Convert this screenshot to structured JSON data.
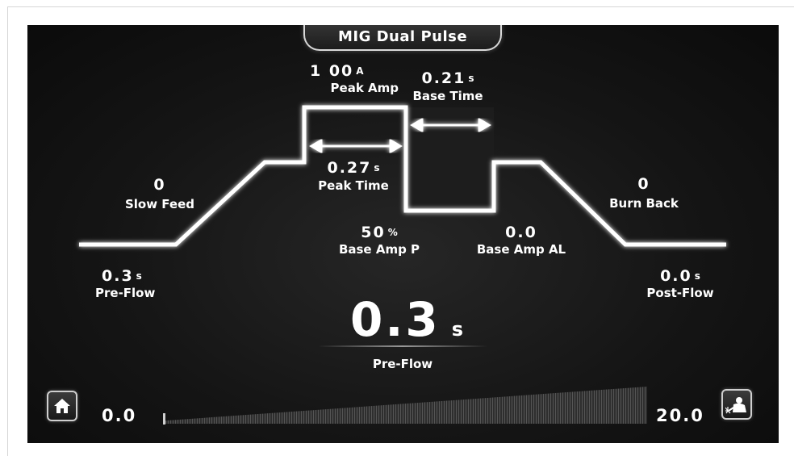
{
  "mode_title": "MIG Dual Pulse",
  "params": {
    "peak_amp": {
      "value": "1 00",
      "unit": "A",
      "label": "Peak Amp"
    },
    "base_time": {
      "value": "0.21",
      "unit": "s",
      "label": "Base Time"
    },
    "peak_time": {
      "value": "0.27",
      "unit": "s",
      "label": "Peak Time"
    },
    "slow_feed": {
      "value": "0",
      "label": "Slow Feed"
    },
    "burn_back": {
      "value": "0",
      "label": "Burn Back"
    },
    "base_amp_p": {
      "value": "50",
      "unit": "%",
      "label": "Base Amp P"
    },
    "base_amp_al": {
      "value": "0.0",
      "label": "Base Amp AL"
    },
    "pre_flow": {
      "value": "0.3",
      "unit": "s",
      "label": "Pre-Flow"
    },
    "post_flow": {
      "value": "0.0",
      "unit": "s",
      "label": "Post-Flow"
    }
  },
  "selected": {
    "value": "0.3",
    "unit": "s",
    "label": "Pre-Flow"
  },
  "slider": {
    "min": "0.0",
    "max": "20.0",
    "level_fraction": 0.015
  },
  "icons": {
    "home": "home-icon",
    "welder": "welder-icon"
  },
  "colors": {
    "screen_bg": "#151515",
    "line": "#ffffff",
    "frame": "#d6d6d6"
  }
}
